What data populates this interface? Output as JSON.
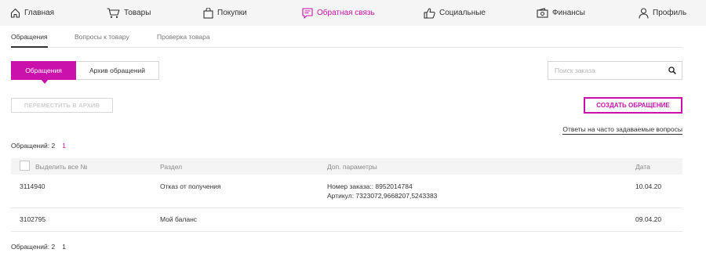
{
  "nav": {
    "items": [
      {
        "label": "Главная",
        "icon": "home-icon"
      },
      {
        "label": "Товары",
        "icon": "cart-icon"
      },
      {
        "label": "Покупки",
        "icon": "bag-icon"
      },
      {
        "label": "Обратная связь",
        "icon": "feedback-icon"
      },
      {
        "label": "Социальные",
        "icon": "thumbs-up-icon"
      },
      {
        "label": "Финансы",
        "icon": "wallet-icon"
      },
      {
        "label": "Профиль",
        "icon": "user-icon"
      }
    ],
    "active": "Обратная связь"
  },
  "subtabs": [
    "Обращения",
    "Вопросы к товару",
    "Проверка товара"
  ],
  "segment": {
    "active": "Обращения",
    "archive": "Архив обращений"
  },
  "search": {
    "placeholder": "Поиск заказа",
    "icon": "search-icon"
  },
  "actions": {
    "archive": "ПЕРЕМЕСТИТЬ В АРХИВ",
    "create": "СОЗДАТЬ ОБРАЩЕНИЕ"
  },
  "faq_link": "Ответы на часто задаваемые вопросы",
  "count": {
    "label": "Обращений: 2",
    "page": "1"
  },
  "table": {
    "headers": {
      "select_all": "Выделить все №",
      "section": "Раздел",
      "params": "Доп. параметры",
      "date": "Дата"
    },
    "rows": [
      {
        "number": "3114940",
        "section": "Отказ от получения",
        "params": [
          "Номер заказа:: 8952014784",
          "Артикул: 7323072,9668207,5243383"
        ],
        "date": "10.04.20"
      },
      {
        "number": "3102795",
        "section": "Мой баланс",
        "params": [
          "",
          ""
        ],
        "date": "09.04.20"
      }
    ]
  },
  "colors": {
    "accent": "#cb11ab",
    "nav_bg": "#f5f5f5",
    "header_bg": "#f4f4f4"
  }
}
